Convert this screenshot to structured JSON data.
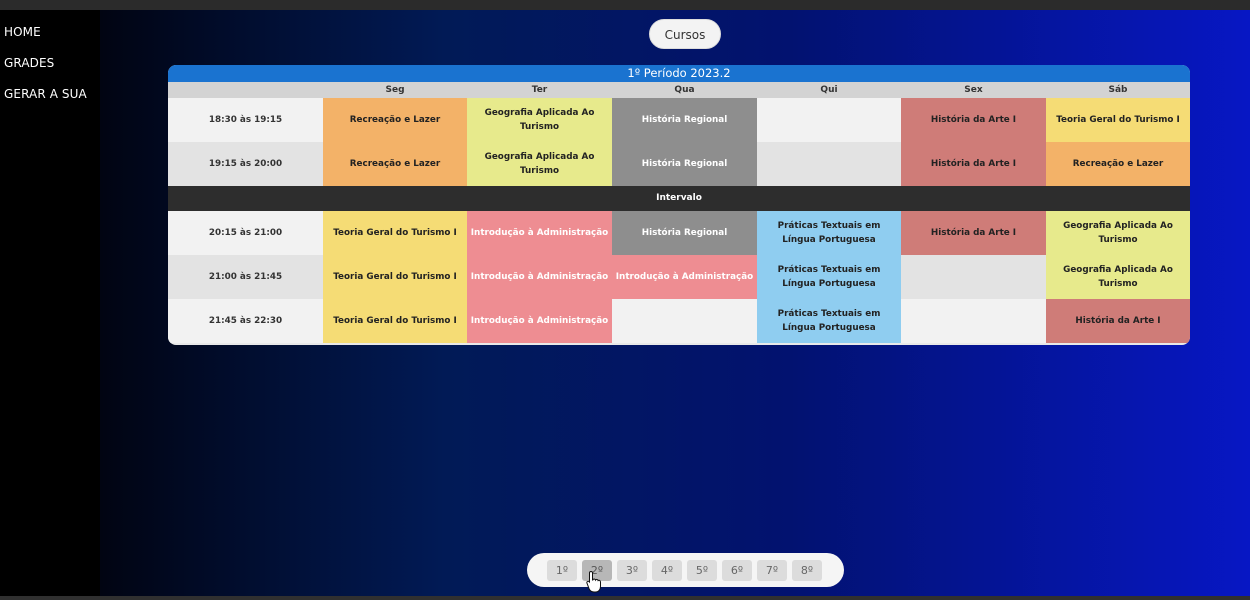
{
  "nav": {
    "items": [
      {
        "label": "HOME"
      },
      {
        "label": "GRADES"
      },
      {
        "label": "GERAR A SUA"
      }
    ]
  },
  "cursos_button": "Cursos",
  "schedule": {
    "title": "1º Período 2023.2",
    "days": [
      "Seg",
      "Ter",
      "Qua",
      "Qui",
      "Sex",
      "Sáb"
    ],
    "break_label": "Intervalo",
    "rows": [
      {
        "time": "18:30 às 19:15",
        "cells": [
          {
            "text": "Recreação e Lazer",
            "bg": "#f3b268",
            "color": "#222222"
          },
          {
            "text": "Geografia Aplicada Ao Turismo",
            "bg": "#e7ea8c",
            "color": "#222222"
          },
          {
            "text": "História Regional",
            "bg": "#8e8e8e",
            "color": "#ffffff"
          },
          {
            "text": "",
            "bg": "",
            "color": ""
          },
          {
            "text": "História da Arte I",
            "bg": "#cf7c78",
            "color": "#222222"
          },
          {
            "text": "Teoria Geral do Turismo I",
            "bg": "#f5dc75",
            "color": "#222222"
          }
        ]
      },
      {
        "time": "19:15 às 20:00",
        "cells": [
          {
            "text": "Recreação e Lazer",
            "bg": "#f3b268",
            "color": "#222222"
          },
          {
            "text": "Geografia Aplicada Ao Turismo",
            "bg": "#e7ea8c",
            "color": "#222222"
          },
          {
            "text": "História Regional",
            "bg": "#8e8e8e",
            "color": "#ffffff"
          },
          {
            "text": "",
            "bg": "",
            "color": ""
          },
          {
            "text": "História da Arte I",
            "bg": "#cf7c78",
            "color": "#222222"
          },
          {
            "text": "Recreação e Lazer",
            "bg": "#f3b268",
            "color": "#222222"
          }
        ]
      },
      {
        "time": "20:15 às 21:00",
        "cells": [
          {
            "text": "Teoria Geral do Turismo I",
            "bg": "#f5dc75",
            "color": "#222222"
          },
          {
            "text": "Introdução à Administração",
            "bg": "#ee8d92",
            "color": "#ffffff"
          },
          {
            "text": "História Regional",
            "bg": "#8e8e8e",
            "color": "#ffffff"
          },
          {
            "text": "Práticas Textuais em Língua Portuguesa",
            "bg": "#8fcdf0",
            "color": "#222222"
          },
          {
            "text": "História da Arte I",
            "bg": "#cf7c78",
            "color": "#222222"
          },
          {
            "text": "Geografia Aplicada Ao Turismo",
            "bg": "#e7ea8c",
            "color": "#222222"
          }
        ]
      },
      {
        "time": "21:00 às 21:45",
        "cells": [
          {
            "text": "Teoria Geral do Turismo I",
            "bg": "#f5dc75",
            "color": "#222222"
          },
          {
            "text": "Introdução à Administração",
            "bg": "#ee8d92",
            "color": "#ffffff"
          },
          {
            "text": "Introdução à Administração",
            "bg": "#ee8d92",
            "color": "#ffffff"
          },
          {
            "text": "Práticas Textuais em Língua Portuguesa",
            "bg": "#8fcdf0",
            "color": "#222222"
          },
          {
            "text": "",
            "bg": "",
            "color": ""
          },
          {
            "text": "Geografia Aplicada Ao Turismo",
            "bg": "#e7ea8c",
            "color": "#222222"
          }
        ]
      },
      {
        "time": "21:45 às 22:30",
        "cells": [
          {
            "text": "Teoria Geral do Turismo I",
            "bg": "#f5dc75",
            "color": "#222222"
          },
          {
            "text": "Introdução à Administração",
            "bg": "#ee8d92",
            "color": "#ffffff"
          },
          {
            "text": "",
            "bg": "",
            "color": ""
          },
          {
            "text": "Práticas Textuais em Língua Portuguesa",
            "bg": "#8fcdf0",
            "color": "#222222"
          },
          {
            "text": "",
            "bg": "",
            "color": ""
          },
          {
            "text": "História da Arte I",
            "bg": "#cf7c78",
            "color": "#222222"
          }
        ]
      }
    ]
  },
  "pager": {
    "pages": [
      "1º",
      "2º",
      "3º",
      "4º",
      "5º",
      "6º",
      "7º",
      "8º"
    ],
    "active_index": 1
  }
}
